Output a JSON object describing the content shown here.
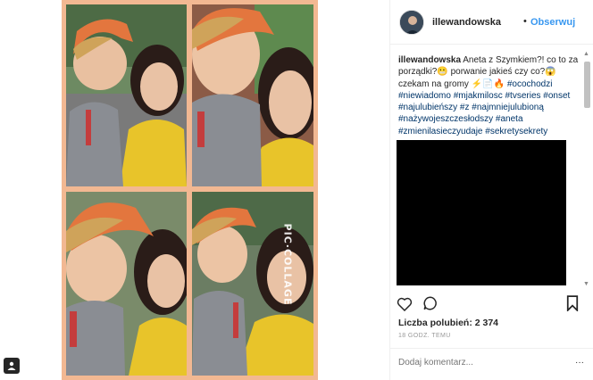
{
  "post": {
    "username": "illewandowska",
    "separator": "•",
    "follow_label": "Obserwuj",
    "caption_user": "illewandowska",
    "caption_text": "Aneta z Szymkiem?! co to za porządki?😬 porwanie jakieś czy co?😱 czekam na gromy ⚡📄🔥 ",
    "hashtags": "#ocochodzi #niewiadomo #mjakmilosc #tvseries #onset #najulubieńszy #z #najmniejulubioną #nażywojeszczesłodszy #aneta #zmienilasieczyudaje #sekretysekrety",
    "likes": "Liczba polubień: 2 374",
    "time": "18 GODZ. TEMU",
    "comment_placeholder": "Dodaj komentarz...",
    "more": "···"
  },
  "collage": {
    "watermark": "PIC·COLLAGE"
  },
  "icons": {
    "heart": "heart-icon",
    "comment": "comment-icon",
    "bookmark": "bookmark-icon",
    "corner": "user-card-icon"
  },
  "colors": {
    "collage_bg": "#f2b892",
    "accent": "#3897f0",
    "text": "#262626"
  }
}
